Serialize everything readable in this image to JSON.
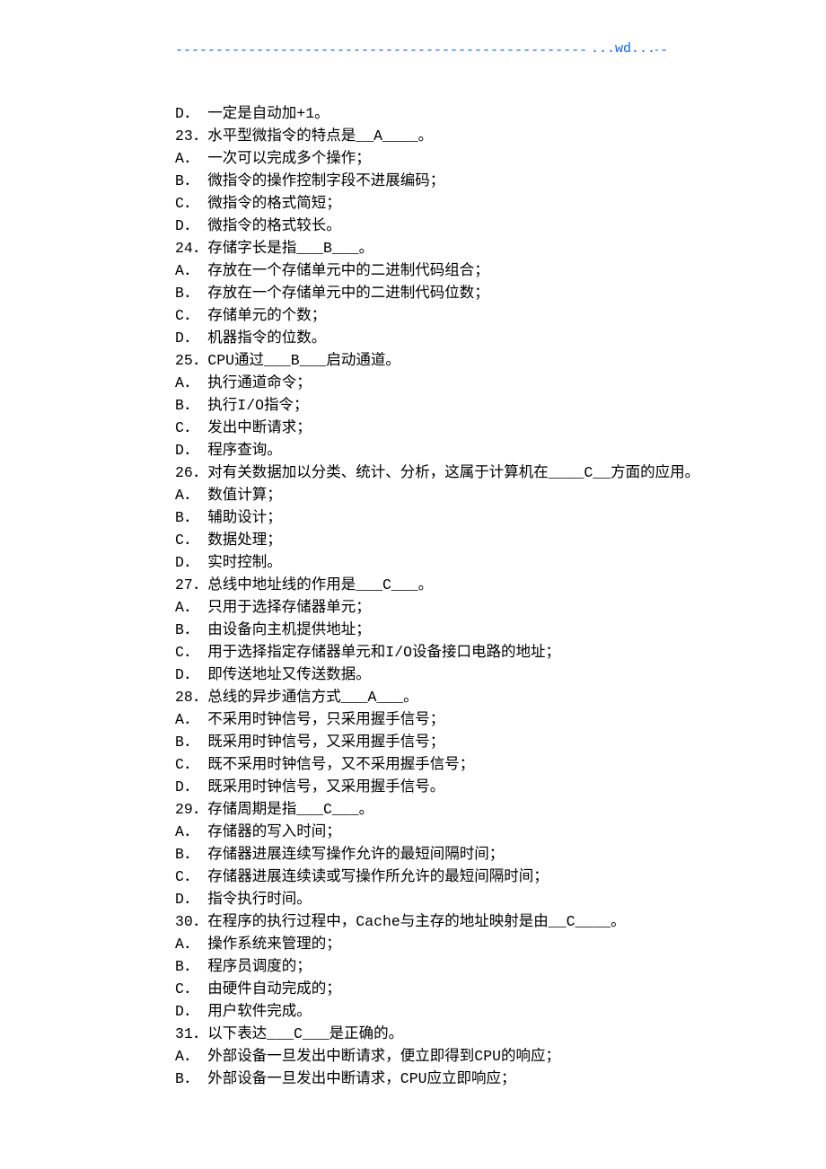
{
  "header": {
    "dashes": "-------------------------------------------------------------",
    "wd": "...wd..."
  },
  "lines": [
    "D． 一定是自动加+1。",
    "23．水平型微指令的特点是__A____。",
    "A． 一次可以完成多个操作；",
    "B． 微指令的操作控制字段不进展编码；",
    "C． 微指令的格式简短；",
    "D． 微指令的格式较长。",
    "24．存储字长是指___B___。",
    "A． 存放在一个存储单元中的二进制代码组合；",
    "B． 存放在一个存储单元中的二进制代码位数；",
    "C． 存储单元的个数；",
    "D． 机器指令的位数。",
    "25．CPU通过___B___启动通道。",
    "A． 执行通道命令；",
    "B． 执行I/O指令；",
    "C． 发出中断请求；",
    "D． 程序查询。",
    "26．对有关数据加以分类、统计、分析，这属于计算机在____C__方面的应用。",
    "A． 数值计算；",
    "B． 辅助设计；",
    "C． 数据处理；",
    "D． 实时控制。",
    "27．总线中地址线的作用是___C___。",
    "A． 只用于选择存储器单元；",
    "B． 由设备向主机提供地址；",
    "C． 用于选择指定存储器单元和I/O设备接口电路的地址；",
    "D． 即传送地址又传送数据。",
    "28．总线的异步通信方式___A___。",
    "A． 不采用时钟信号，只采用握手信号；",
    "B． 既采用时钟信号，又采用握手信号；",
    "C． 既不采用时钟信号，又不采用握手信号；",
    "D． 既采用时钟信号，又采用握手信号。",
    "29．存储周期是指___C___。",
    "A． 存储器的写入时间；",
    "B． 存储器进展连续写操作允许的最短间隔时间；",
    "C． 存储器进展连续读或写操作所允许的最短间隔时间；",
    "D． 指令执行时间。",
    "30．在程序的执行过程中，Cache与主存的地址映射是由__C____。",
    "A． 操作系统来管理的；",
    "B． 程序员调度的；",
    "C． 由硬件自动完成的；",
    "D． 用户软件完成。",
    "31．以下表达___C___是正确的。",
    "A． 外部设备一旦发出中断请求，便立即得到CPU的响应；",
    "B． 外部设备一旦发出中断请求，CPU应立即响应；"
  ]
}
